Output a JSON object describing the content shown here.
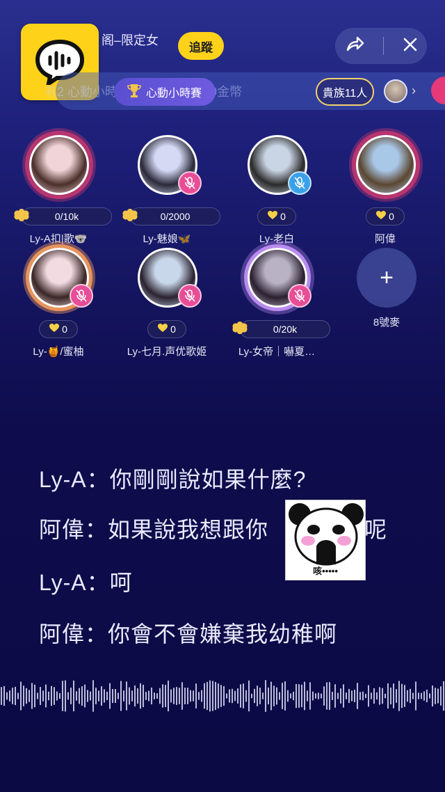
{
  "header": {
    "room_title": "阁–限定女",
    "follow_label": "追蹤"
  },
  "marquee": {
    "text": "有2 心動小時賽 獎贏得價值250金幣",
    "pill_label": "心動小時賽",
    "noble_label": "貴族11人",
    "chevron": "›"
  },
  "seats": [
    {
      "name": "Ly-A扣|歌🐨",
      "gift": "0/10k",
      "gift_type": "trophy",
      "mute": "none",
      "ring": "pink",
      "avatar_colors": [
        "#f1d4d8",
        "#4a2f2a"
      ]
    },
    {
      "name": "Ly-魅娘🦋",
      "gift": "0/2000",
      "gift_type": "trophy",
      "mute": "pink",
      "ring": "none",
      "avatar_colors": [
        "#d5d9f4",
        "#2a2a3a"
      ]
    },
    {
      "name": "Ly-老白",
      "gift": "0",
      "gift_type": "heart",
      "mute": "blue",
      "ring": "none",
      "avatar_colors": [
        "#c9d4e4",
        "#2b2b2b"
      ]
    },
    {
      "name": "阿偉",
      "gift": "0",
      "gift_type": "heart",
      "mute": "none",
      "ring": "pink",
      "avatar_colors": [
        "#a9c8e8",
        "#5b4630"
      ]
    },
    {
      "name": "Ly-🍯/蜜柚",
      "gift": "0",
      "gift_type": "heart",
      "mute": "pink",
      "ring": "orange",
      "avatar_colors": [
        "#f3dbe2",
        "#3a2626"
      ]
    },
    {
      "name": "Ly-七月.声优歌姬",
      "gift": "0",
      "gift_type": "heart",
      "mute": "pink",
      "ring": "none",
      "avatar_colors": [
        "#c8d7ea",
        "#2a2230"
      ]
    },
    {
      "name": "Ly-女帝｜嚇夏…",
      "gift": "0/20k",
      "gift_type": "trophy",
      "mute": "pink",
      "ring": "purple",
      "avatar_colors": [
        "#b9b2c4",
        "#2a2030"
      ]
    }
  ],
  "add_seat": {
    "label": "8號麥",
    "icon": "+"
  },
  "lyrics": [
    "Ly-A：你剛剛說如果什麼?",
    "阿偉：如果說我想跟你",
    "呢",
    "Ly-A：呵",
    "阿偉：你會不會嫌棄我幼稚啊"
  ],
  "sticker": {
    "caption": "咳•••••"
  },
  "colors": {
    "accent_yellow": "#ffd21a",
    "mute_pink": "#e84d97",
    "mute_blue": "#3aa0ea"
  }
}
